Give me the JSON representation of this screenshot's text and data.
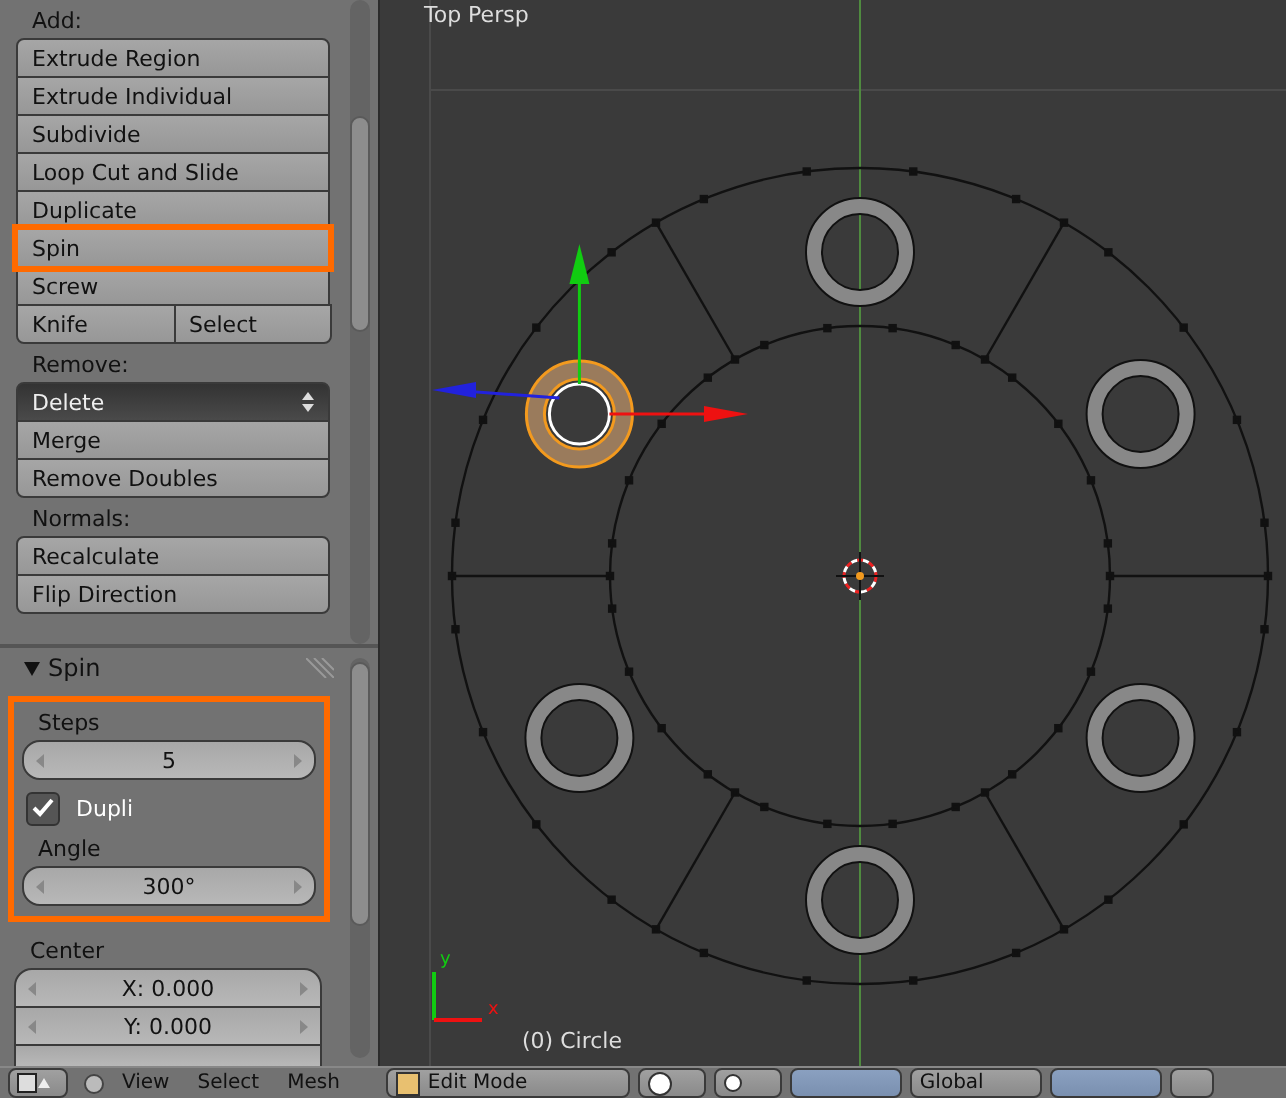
{
  "tool_shelf": {
    "sections": [
      {
        "heading": "Add:",
        "items": [
          {
            "kind": "button",
            "label": "Extrude Region",
            "highlighted": false
          },
          {
            "kind": "button",
            "label": "Extrude Individual",
            "highlighted": false
          },
          {
            "kind": "button",
            "label": "Subdivide",
            "highlighted": false
          },
          {
            "kind": "button",
            "label": "Loop Cut and Slide",
            "highlighted": false
          },
          {
            "kind": "button",
            "label": "Duplicate",
            "highlighted": false
          },
          {
            "kind": "button",
            "label": "Spin",
            "highlighted": true
          },
          {
            "kind": "button",
            "label": "Screw",
            "highlighted": false
          },
          {
            "kind": "pair",
            "labels": [
              "Knife",
              "Select"
            ],
            "highlighted": false
          }
        ]
      },
      {
        "heading": "Remove:",
        "items": [
          {
            "kind": "dropdown",
            "label": "Delete",
            "highlighted": false
          },
          {
            "kind": "button",
            "label": "Merge",
            "highlighted": false
          },
          {
            "kind": "button",
            "label": "Remove Doubles",
            "highlighted": false
          }
        ]
      },
      {
        "heading": "Normals:",
        "items": [
          {
            "kind": "button",
            "label": "Recalculate",
            "highlighted": false
          },
          {
            "kind": "button",
            "label": "Flip Direction",
            "highlighted": false
          }
        ]
      }
    ]
  },
  "operator_panel": {
    "title": "Spin",
    "expanded": true,
    "highlighted_fields": [
      {
        "kind": "label",
        "text": "Steps"
      },
      {
        "kind": "number",
        "value": "5"
      },
      {
        "kind": "checkbox",
        "label": "Dupli",
        "checked": true
      },
      {
        "kind": "label",
        "text": "Angle"
      },
      {
        "kind": "number",
        "value": "300°"
      }
    ],
    "fields": [
      {
        "kind": "label",
        "text": "Center"
      },
      {
        "kind": "number",
        "value": "X: 0.000"
      },
      {
        "kind": "number",
        "value": "Y: 0.000"
      }
    ]
  },
  "viewport": {
    "view_name": "Top Persp",
    "axis_labels": [
      "y",
      "x"
    ],
    "object_info": "(0) Circle"
  },
  "header": {
    "menus": [
      "View",
      "Select",
      "Mesh"
    ],
    "mode": "Edit Mode",
    "orientation": "Global"
  }
}
